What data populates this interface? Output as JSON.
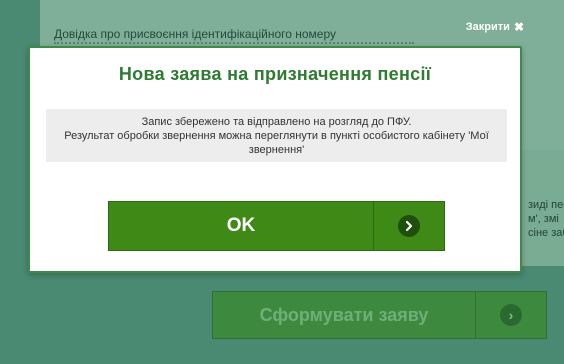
{
  "background": {
    "doc_label": "Довідка про присвоєння ідентифікаційного номеру",
    "side_text": [
      "зиді пен",
      "м', змі",
      "сіне заб"
    ],
    "submit_label": "Сформувати заяву"
  },
  "close": {
    "label": "Закрити",
    "icon": "close-icon"
  },
  "modal": {
    "title": "Нова заява на призначення пенсії",
    "message_line1": "Запис збережено та відправлено на розгляд до ПФУ.",
    "message_line2": "Результат обробки звернення можна переглянути в пункті особистого кабінету 'Мої звернення'",
    "ok_label": "OK",
    "ok_icon": "chevron-right-icon"
  },
  "colors": {
    "accent_green": "#3f8a17",
    "title_green": "#2e7b32",
    "overlay": "#4a8a72"
  }
}
